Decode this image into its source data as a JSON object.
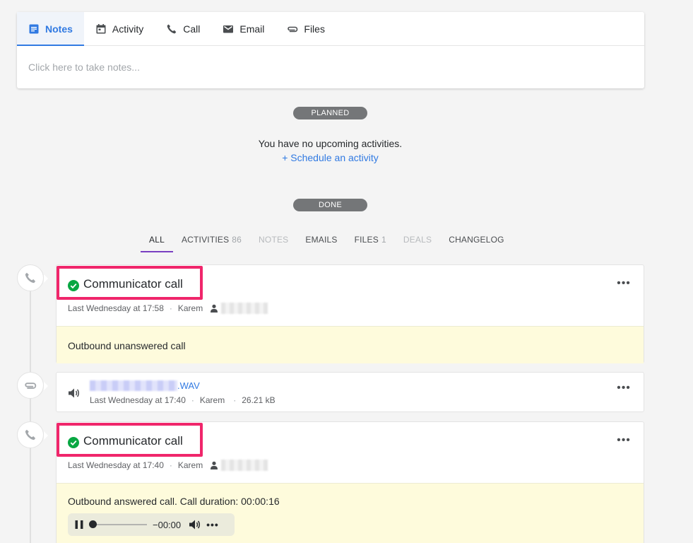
{
  "composer": {
    "tabs": [
      {
        "label": "Notes",
        "icon": "notes-icon",
        "active": true
      },
      {
        "label": "Activity",
        "icon": "calendar-icon"
      },
      {
        "label": "Call",
        "icon": "phone-icon"
      },
      {
        "label": "Email",
        "icon": "mail-icon"
      },
      {
        "label": "Files",
        "icon": "paperclip-icon"
      }
    ],
    "notes_placeholder": "Click here to take notes..."
  },
  "planned": {
    "pill": "PLANNED",
    "empty_text": "You have no upcoming activities.",
    "schedule_link": "+ Schedule an activity"
  },
  "done": {
    "pill": "DONE"
  },
  "filters": [
    {
      "label": "ALL",
      "count": "",
      "active": true
    },
    {
      "label": "ACTIVITIES",
      "count": "86"
    },
    {
      "label": "NOTES",
      "count": "",
      "disabled": true
    },
    {
      "label": "EMAILS",
      "count": ""
    },
    {
      "label": "FILES",
      "count": "1"
    },
    {
      "label": "DEALS",
      "count": "",
      "disabled": true
    },
    {
      "label": "CHANGELOG",
      "count": ""
    }
  ],
  "feed": {
    "call1": {
      "title": "Communicator call",
      "time": "Last Wednesday at 17:58",
      "user": "Karem",
      "body": "Outbound unanswered call"
    },
    "file": {
      "ext": ".WAV",
      "time": "Last Wednesday at 17:40",
      "user": "Karem",
      "size": "26.21 kB"
    },
    "call2": {
      "title": "Communicator call",
      "time": "Last Wednesday at 17:40",
      "user": "Karem",
      "body": "Outbound answered call. Call duration: 00:00:16",
      "player_time": "−00:00",
      "player_progress": 0.0
    }
  },
  "colors": {
    "accent": "#317ae2",
    "highlight": "#f0266b",
    "success": "#08a742",
    "active_filter": "#7a3fc2",
    "note_bg": "#fefbdc"
  },
  "separator": "·",
  "more_glyph": "•••"
}
